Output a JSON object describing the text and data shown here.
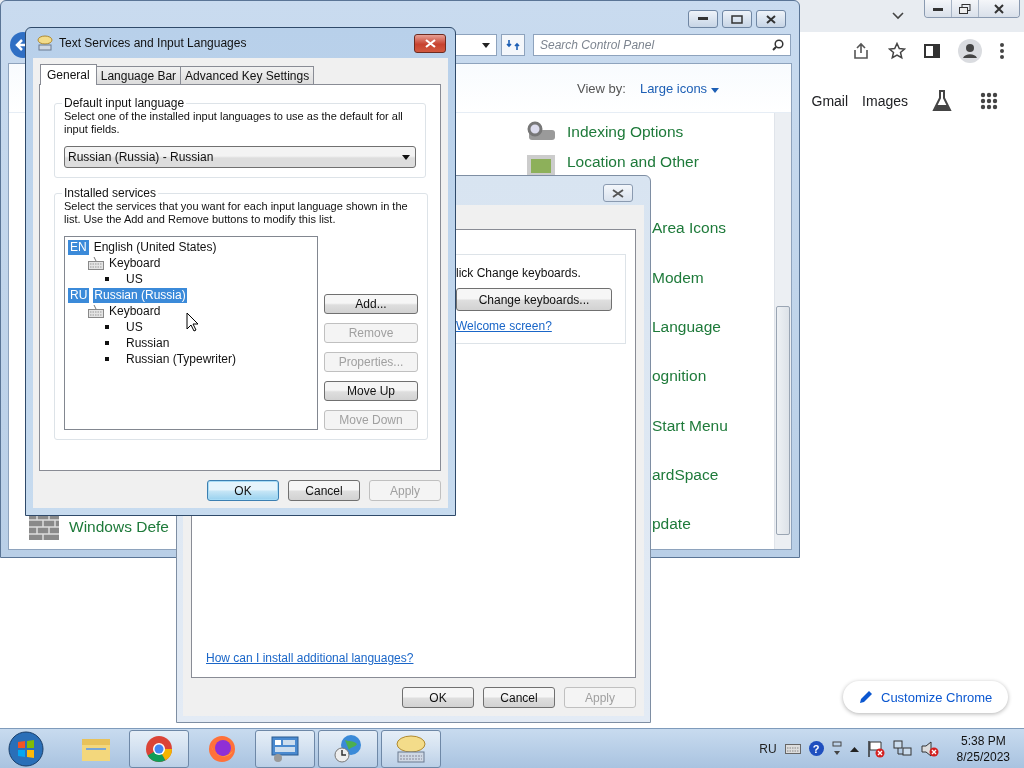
{
  "chrome": {
    "links": [
      "Gmail",
      "Images"
    ],
    "customize_button": "Customize Chrome"
  },
  "control_panel": {
    "search": {
      "placeholder": "Search Control Panel"
    },
    "view_by": {
      "label": "View by:",
      "value": "Large icons"
    },
    "items": [
      {
        "label": "Indexing Options",
        "kind": "icon"
      },
      {
        "label": "Location and Other",
        "kind": "icon"
      },
      {
        "label": "Area Icons",
        "kind": "cut"
      },
      {
        "label": "Modem",
        "kind": "cut"
      },
      {
        "label": "Language",
        "kind": "cut"
      },
      {
        "label": "ognition",
        "kind": "cut"
      },
      {
        "label": "Start Menu",
        "kind": "cut"
      },
      {
        "label": "ardSpace",
        "kind": "cut"
      },
      {
        "label": "pdate",
        "kind": "cut"
      }
    ],
    "left_items": [
      {
        "label": "Windows Defe"
      }
    ]
  },
  "region_dialog": {
    "instruction": "lick Change keyboards.",
    "change_button": "Change keyboards...",
    "welcome_link": "Welcome screen?",
    "install_link": "How can I install additional languages?",
    "buttons": [
      {
        "label": "OK",
        "disabled": false,
        "default": false
      },
      {
        "label": "Cancel",
        "disabled": false,
        "default": false
      },
      {
        "label": "Apply",
        "disabled": true,
        "default": false
      }
    ]
  },
  "text_services": {
    "title": "Text Services and Input Languages",
    "tabs": [
      {
        "label": "General",
        "selected": true
      },
      {
        "label": "Language Bar",
        "selected": false
      },
      {
        "label": "Advanced Key Settings",
        "selected": false
      }
    ],
    "default_group": {
      "legend": "Default input language",
      "description": "Select one of the installed input languages to use as the default for all input fields.",
      "value": "Russian (Russia) - Russian"
    },
    "services_group": {
      "legend": "Installed services",
      "description": "Select the services that you want for each input language shown in the list. Use the Add and Remove buttons to modify this list.",
      "tree": [
        {
          "badge": "EN",
          "label": "English (United States)",
          "selected": false,
          "children": [
            {
              "label": "Keyboard",
              "selected": false,
              "children": [
                {
                  "label": "US",
                  "selected": false
                }
              ]
            }
          ]
        },
        {
          "badge": "RU",
          "label": "Russian (Russia)",
          "selected": true,
          "children": [
            {
              "label": "Keyboard",
              "selected": false,
              "children": [
                {
                  "label": "US",
                  "selected": false
                },
                {
                  "label": "Russian",
                  "selected": false
                },
                {
                  "label": "Russian (Typewriter)",
                  "selected": false
                }
              ]
            }
          ]
        }
      ],
      "buttons": [
        {
          "label": "Add...",
          "disabled": false
        },
        {
          "label": "Remove",
          "disabled": true
        },
        {
          "label": "Properties...",
          "disabled": true
        },
        {
          "label": "Move Up",
          "disabled": false
        },
        {
          "label": "Move Down",
          "disabled": true
        }
      ]
    },
    "buttons": [
      {
        "label": "OK",
        "disabled": false,
        "default": true
      },
      {
        "label": "Cancel",
        "disabled": false,
        "default": false
      },
      {
        "label": "Apply",
        "disabled": true,
        "default": false
      }
    ]
  },
  "taskbar": {
    "apps": [
      {
        "kind": "explorer",
        "open": false
      },
      {
        "kind": "chrome",
        "open": true
      },
      {
        "kind": "firefox",
        "open": false
      },
      {
        "kind": "control-panel",
        "open": true
      },
      {
        "kind": "clock-globe",
        "open": true
      },
      {
        "kind": "keyboard",
        "open": true
      }
    ],
    "tray": {
      "language": "RU",
      "help": "?",
      "time": "5:38 PM",
      "date": "8/25/2023"
    }
  }
}
